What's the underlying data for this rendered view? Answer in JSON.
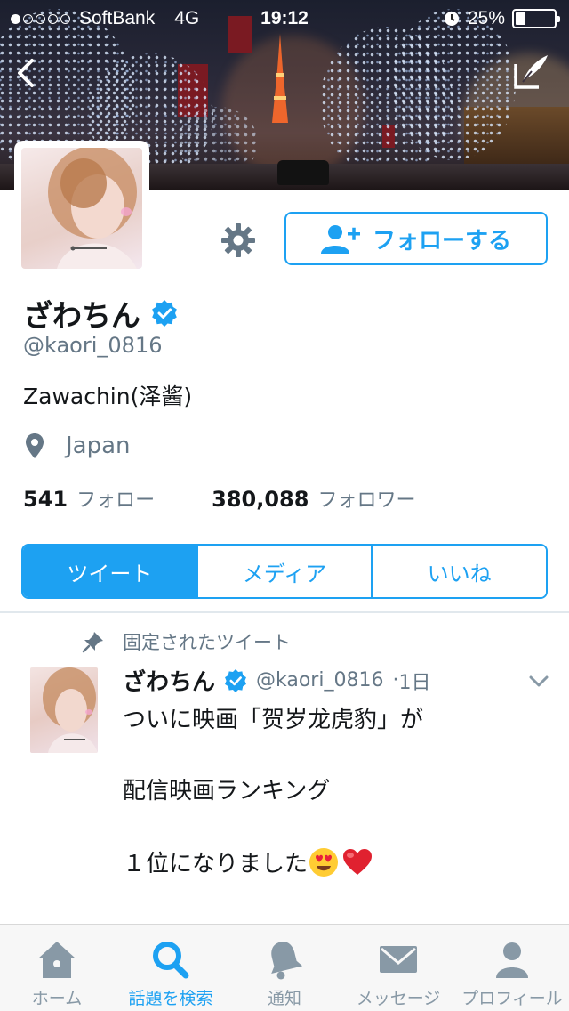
{
  "status_bar": {
    "carrier": "SoftBank",
    "network": "4G",
    "time": "19:12",
    "battery_text": "25%",
    "battery_level": 0.25
  },
  "profile": {
    "follow_button_label": "フォローする",
    "name": "ざわちん",
    "handle": "@kaori_0816",
    "bio": "Zawachin(泽酱)",
    "location": "Japan",
    "following_count": "541",
    "following_label": "フォロー",
    "followers_count": "380,088",
    "followers_label": "フォロワー"
  },
  "tabs": [
    {
      "label": "ツイート",
      "active": true
    },
    {
      "label": "メディア",
      "active": false
    },
    {
      "label": "いいね",
      "active": false
    }
  ],
  "tweet": {
    "pinned_label": "固定されたツイート",
    "name": "ざわちん",
    "handle": "@kaori_0816",
    "age": "1日",
    "line1": "ついに映画「贺岁龙虎豹」が",
    "line2": "配信映画ランキング",
    "line3": "１位になりました"
  },
  "bottom_nav": [
    {
      "label": "ホーム",
      "icon": "home-icon",
      "active": false
    },
    {
      "label": "話題を検索",
      "icon": "search-icon",
      "active": true
    },
    {
      "label": "通知",
      "icon": "bell-icon",
      "active": false
    },
    {
      "label": "メッセージ",
      "icon": "envelope-icon",
      "active": false
    },
    {
      "label": "プロフィール",
      "icon": "person-icon",
      "active": false
    }
  ],
  "colors": {
    "accent": "#1da1f2",
    "secondary_text": "#657786",
    "verified": "#1da1f2",
    "tab_inactive": "#8899a6"
  }
}
